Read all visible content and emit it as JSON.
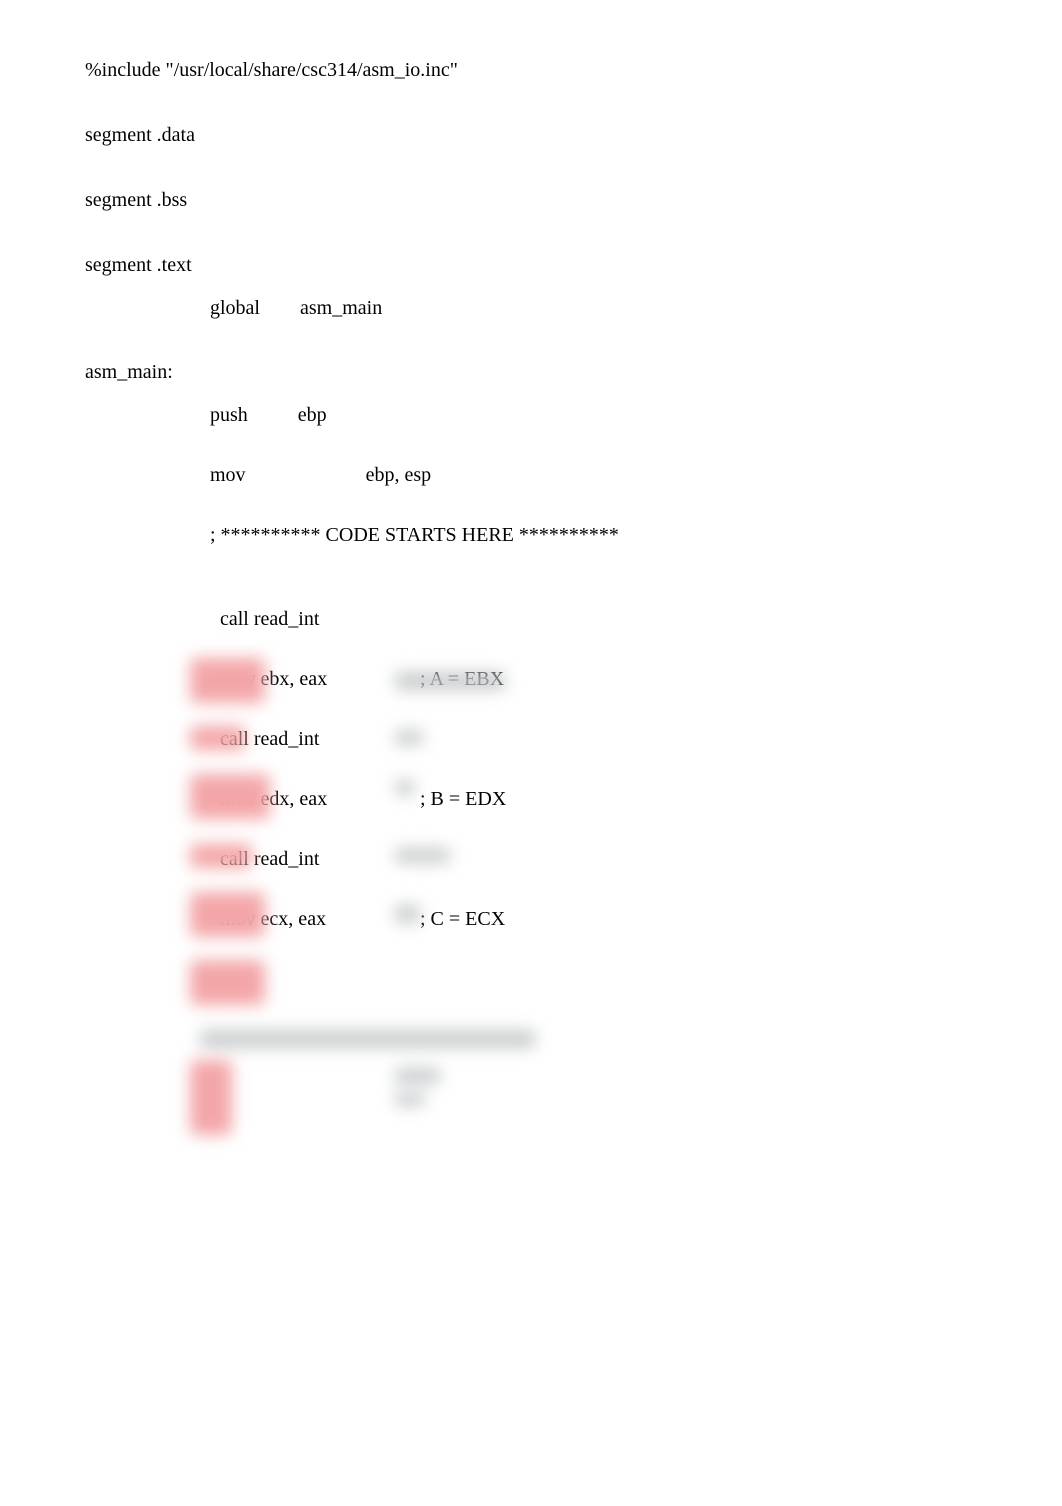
{
  "include_line": "%include \"/usr/local/share/csc314/asm_io.inc\"",
  "segments": {
    "data": "segment .data",
    "bss": "segment .bss",
    "text": "segment .text"
  },
  "global_decl": {
    "kw": "global",
    "sym": "asm_main"
  },
  "label_main": "asm_main:",
  "prologue": {
    "push": "push",
    "push_arg": "ebp",
    "mov": "mov",
    "mov_args": "ebp, esp"
  },
  "code_start": "; ********** CODE STARTS HERE **********",
  "reads": [
    {
      "call": "call read_int",
      "mov": "mov ebx, eax",
      "comment": "; A = EBX"
    },
    {
      "call": "call read_int",
      "mov": "mov edx, eax",
      "comment": "; B = EDX"
    },
    {
      "call": "call read_int",
      "mov": "mov ecx, eax",
      "comment": "; C = ECX"
    }
  ]
}
